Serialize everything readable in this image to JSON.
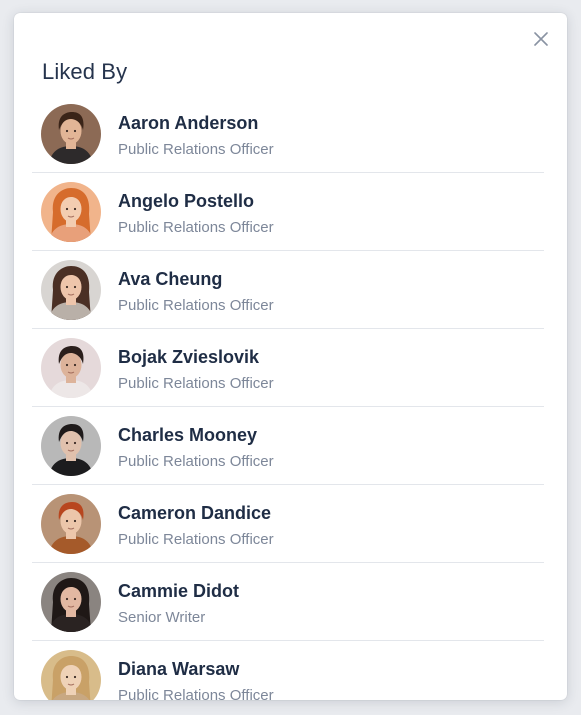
{
  "modal": {
    "title": "Liked By",
    "close_icon": "close-icon"
  },
  "people": [
    {
      "name": "Aaron Anderson",
      "role": "Public Relations Officer",
      "avatar": {
        "bg": "#8c6a55",
        "skin": "#e2b596",
        "hair": "#3a2418",
        "shirt": "#2d2a2b",
        "hair_style": "short"
      }
    },
    {
      "name": "Angelo Postello",
      "role": "Public Relations Officer",
      "avatar": {
        "bg": "#f1b48b",
        "skin": "#f3cdb1",
        "hair": "#d66c2c",
        "shirt": "#e8a07a",
        "hair_style": "long"
      }
    },
    {
      "name": "Ava Cheung",
      "role": "Public Relations Officer",
      "avatar": {
        "bg": "#d8d5d2",
        "skin": "#eec5ab",
        "hair": "#4a2f24",
        "shirt": "#b9b0a8",
        "hair_style": "long"
      }
    },
    {
      "name": "Bojak Zvieslovik",
      "role": "Public Relations Officer",
      "avatar": {
        "bg": "#e5d9da",
        "skin": "#ddb39a",
        "hair": "#2b1f1c",
        "shirt": "#ede7e7",
        "hair_style": "short"
      }
    },
    {
      "name": "Charles Mooney",
      "role": "Public Relations Officer",
      "avatar": {
        "bg": "#b8b8b8",
        "skin": "#e0c1ad",
        "hair": "#1e1a1a",
        "shirt": "#1c1c1e",
        "hair_style": "short"
      }
    },
    {
      "name": "Cameron Dandice",
      "role": "Public Relations Officer",
      "avatar": {
        "bg": "#b89376",
        "skin": "#ecc6aa",
        "hair": "#b8461e",
        "shirt": "#a55a2a",
        "hair_style": "short"
      }
    },
    {
      "name": "Cammie Didot",
      "role": "Senior Writer",
      "avatar": {
        "bg": "#8a8480",
        "skin": "#e2b8a2",
        "hair": "#1f1816",
        "shirt": "#2a2322",
        "hair_style": "long"
      }
    },
    {
      "name": "Diana Warsaw",
      "role": "Public Relations Officer",
      "avatar": {
        "bg": "#d8bc8a",
        "skin": "#efd2b7",
        "hair": "#c9a167",
        "shirt": "#c8a882",
        "hair_style": "long"
      }
    }
  ]
}
